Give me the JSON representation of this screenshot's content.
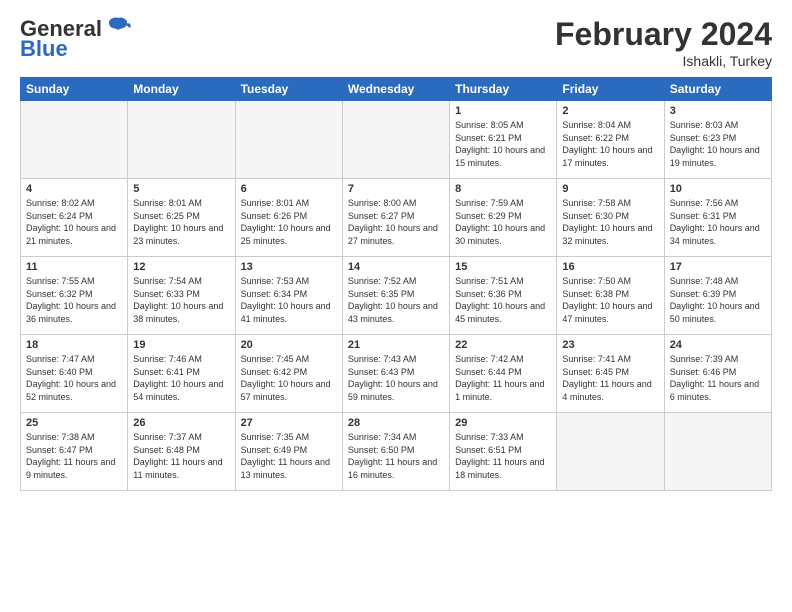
{
  "header": {
    "logo_general": "General",
    "logo_blue": "Blue",
    "month_title": "February 2024",
    "location": "Ishakli, Turkey"
  },
  "days_of_week": [
    "Sunday",
    "Monday",
    "Tuesday",
    "Wednesday",
    "Thursday",
    "Friday",
    "Saturday"
  ],
  "weeks": [
    [
      {
        "day": "",
        "empty": true
      },
      {
        "day": "",
        "empty": true
      },
      {
        "day": "",
        "empty": true
      },
      {
        "day": "",
        "empty": true
      },
      {
        "day": "1",
        "sunrise": "8:05 AM",
        "sunset": "6:21 PM",
        "daylight": "10 hours and 15 minutes."
      },
      {
        "day": "2",
        "sunrise": "8:04 AM",
        "sunset": "6:22 PM",
        "daylight": "10 hours and 17 minutes."
      },
      {
        "day": "3",
        "sunrise": "8:03 AM",
        "sunset": "6:23 PM",
        "daylight": "10 hours and 19 minutes."
      }
    ],
    [
      {
        "day": "4",
        "sunrise": "8:02 AM",
        "sunset": "6:24 PM",
        "daylight": "10 hours and 21 minutes."
      },
      {
        "day": "5",
        "sunrise": "8:01 AM",
        "sunset": "6:25 PM",
        "daylight": "10 hours and 23 minutes."
      },
      {
        "day": "6",
        "sunrise": "8:01 AM",
        "sunset": "6:26 PM",
        "daylight": "10 hours and 25 minutes."
      },
      {
        "day": "7",
        "sunrise": "8:00 AM",
        "sunset": "6:27 PM",
        "daylight": "10 hours and 27 minutes."
      },
      {
        "day": "8",
        "sunrise": "7:59 AM",
        "sunset": "6:29 PM",
        "daylight": "10 hours and 30 minutes."
      },
      {
        "day": "9",
        "sunrise": "7:58 AM",
        "sunset": "6:30 PM",
        "daylight": "10 hours and 32 minutes."
      },
      {
        "day": "10",
        "sunrise": "7:56 AM",
        "sunset": "6:31 PM",
        "daylight": "10 hours and 34 minutes."
      }
    ],
    [
      {
        "day": "11",
        "sunrise": "7:55 AM",
        "sunset": "6:32 PM",
        "daylight": "10 hours and 36 minutes."
      },
      {
        "day": "12",
        "sunrise": "7:54 AM",
        "sunset": "6:33 PM",
        "daylight": "10 hours and 38 minutes."
      },
      {
        "day": "13",
        "sunrise": "7:53 AM",
        "sunset": "6:34 PM",
        "daylight": "10 hours and 41 minutes."
      },
      {
        "day": "14",
        "sunrise": "7:52 AM",
        "sunset": "6:35 PM",
        "daylight": "10 hours and 43 minutes."
      },
      {
        "day": "15",
        "sunrise": "7:51 AM",
        "sunset": "6:36 PM",
        "daylight": "10 hours and 45 minutes."
      },
      {
        "day": "16",
        "sunrise": "7:50 AM",
        "sunset": "6:38 PM",
        "daylight": "10 hours and 47 minutes."
      },
      {
        "day": "17",
        "sunrise": "7:48 AM",
        "sunset": "6:39 PM",
        "daylight": "10 hours and 50 minutes."
      }
    ],
    [
      {
        "day": "18",
        "sunrise": "7:47 AM",
        "sunset": "6:40 PM",
        "daylight": "10 hours and 52 minutes."
      },
      {
        "day": "19",
        "sunrise": "7:46 AM",
        "sunset": "6:41 PM",
        "daylight": "10 hours and 54 minutes."
      },
      {
        "day": "20",
        "sunrise": "7:45 AM",
        "sunset": "6:42 PM",
        "daylight": "10 hours and 57 minutes."
      },
      {
        "day": "21",
        "sunrise": "7:43 AM",
        "sunset": "6:43 PM",
        "daylight": "10 hours and 59 minutes."
      },
      {
        "day": "22",
        "sunrise": "7:42 AM",
        "sunset": "6:44 PM",
        "daylight": "11 hours and 1 minute."
      },
      {
        "day": "23",
        "sunrise": "7:41 AM",
        "sunset": "6:45 PM",
        "daylight": "11 hours and 4 minutes."
      },
      {
        "day": "24",
        "sunrise": "7:39 AM",
        "sunset": "6:46 PM",
        "daylight": "11 hours and 6 minutes."
      }
    ],
    [
      {
        "day": "25",
        "sunrise": "7:38 AM",
        "sunset": "6:47 PM",
        "daylight": "11 hours and 9 minutes."
      },
      {
        "day": "26",
        "sunrise": "7:37 AM",
        "sunset": "6:48 PM",
        "daylight": "11 hours and 11 minutes."
      },
      {
        "day": "27",
        "sunrise": "7:35 AM",
        "sunset": "6:49 PM",
        "daylight": "11 hours and 13 minutes."
      },
      {
        "day": "28",
        "sunrise": "7:34 AM",
        "sunset": "6:50 PM",
        "daylight": "11 hours and 16 minutes."
      },
      {
        "day": "29",
        "sunrise": "7:33 AM",
        "sunset": "6:51 PM",
        "daylight": "11 hours and 18 minutes."
      },
      {
        "day": "",
        "empty": true
      },
      {
        "day": "",
        "empty": true
      }
    ]
  ],
  "labels": {
    "sunrise": "Sunrise:",
    "sunset": "Sunset:",
    "daylight": "Daylight:"
  }
}
